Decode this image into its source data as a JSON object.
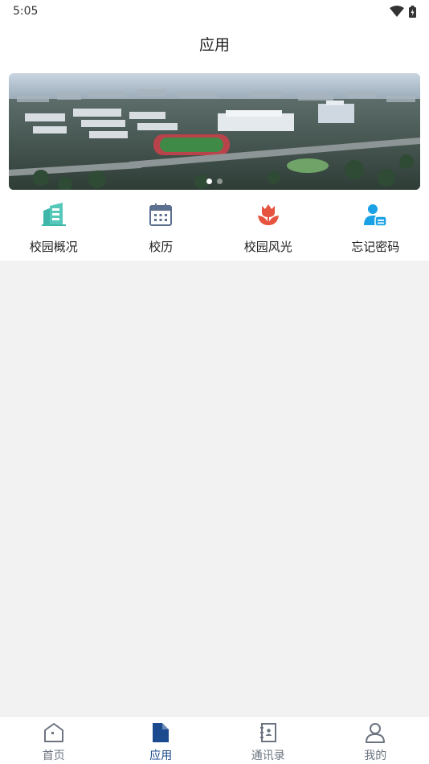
{
  "status": {
    "time": "5:05"
  },
  "header": {
    "title": "应用"
  },
  "banner": {
    "slides": 2,
    "active_index": 0
  },
  "grid": [
    {
      "label": "校园概况",
      "icon": "building-icon",
      "color": "#3fb7a8"
    },
    {
      "label": "校历",
      "icon": "calendar-icon",
      "color": "#5b6f8f"
    },
    {
      "label": "校园风光",
      "icon": "tulip-icon",
      "color": "#e6533f"
    },
    {
      "label": "忘记密码",
      "icon": "user-lock-icon",
      "color": "#1aa1e6"
    }
  ],
  "nav": [
    {
      "label": "首页",
      "icon": "home-icon",
      "active": false
    },
    {
      "label": "应用",
      "icon": "document-icon",
      "active": true
    },
    {
      "label": "通讯录",
      "icon": "contacts-book-icon",
      "active": false
    },
    {
      "label": "我的",
      "icon": "person-icon",
      "active": false
    }
  ],
  "colors": {
    "accent": "#1b4a8f",
    "inactive": "#6c7480",
    "background": "#f2f2f2"
  }
}
